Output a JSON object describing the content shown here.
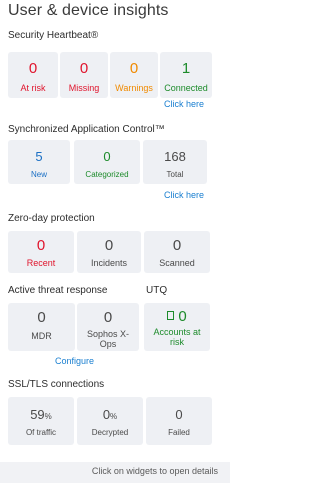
{
  "title": "User & device insights",
  "heartbeat": {
    "label": "Security Heartbeat®",
    "at_risk_value": "0",
    "at_risk_label": "At risk",
    "missing_value": "0",
    "missing_label": "Missing",
    "warnings_value": "0",
    "warnings_label": "Warnings",
    "connected_value": "1",
    "connected_label": "Connected",
    "link": "Click here"
  },
  "app_control": {
    "label": "Synchronized Application Control™",
    "new_value": "5",
    "new_label": "New",
    "categorized_value": "0",
    "categorized_label": "Categorized",
    "total_value": "168",
    "total_label": "Total",
    "link": "Click here"
  },
  "zero_day": {
    "label": "Zero-day protection",
    "recent_value": "0",
    "recent_label": "Recent",
    "incidents_value": "0",
    "incidents_label": "Incidents",
    "scanned_value": "0",
    "scanned_label": "Scanned"
  },
  "threat_response": {
    "label": "Active threat response",
    "mdr_value": "0",
    "mdr_label": "MDR",
    "xops_value": "0",
    "xops_label": "Sophos X-Ops",
    "link": "Configure"
  },
  "utq": {
    "label": "UTQ",
    "accounts_value": "0",
    "accounts_label": "Accounts at risk"
  },
  "ssl": {
    "label": "SSL/TLS connections",
    "traffic_value": "59",
    "traffic_unit": "%",
    "traffic_label": "Of traffic",
    "decrypted_value": "0",
    "decrypted_unit": "%",
    "decrypted_label": "Decrypted",
    "failed_value": "0",
    "failed_label": "Failed"
  },
  "footer": "Click on widgets to open details",
  "colors": {
    "red": "#e0142c",
    "orange": "#f08a00",
    "green": "#1d8b2b",
    "blue": "#1a6fc4",
    "link": "#1a7fd0"
  }
}
